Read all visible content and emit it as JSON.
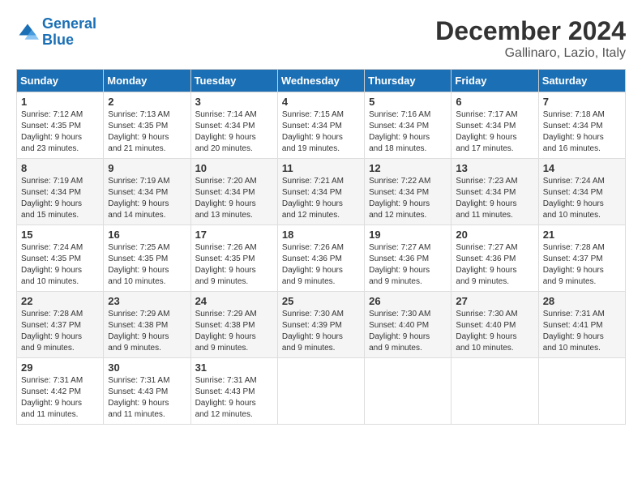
{
  "header": {
    "logo_line1": "General",
    "logo_line2": "Blue",
    "month": "December 2024",
    "location": "Gallinaro, Lazio, Italy"
  },
  "weekdays": [
    "Sunday",
    "Monday",
    "Tuesday",
    "Wednesday",
    "Thursday",
    "Friday",
    "Saturday"
  ],
  "weeks": [
    [
      {
        "day": "1",
        "info": "Sunrise: 7:12 AM\nSunset: 4:35 PM\nDaylight: 9 hours\nand 23 minutes."
      },
      {
        "day": "2",
        "info": "Sunrise: 7:13 AM\nSunset: 4:35 PM\nDaylight: 9 hours\nand 21 minutes."
      },
      {
        "day": "3",
        "info": "Sunrise: 7:14 AM\nSunset: 4:34 PM\nDaylight: 9 hours\nand 20 minutes."
      },
      {
        "day": "4",
        "info": "Sunrise: 7:15 AM\nSunset: 4:34 PM\nDaylight: 9 hours\nand 19 minutes."
      },
      {
        "day": "5",
        "info": "Sunrise: 7:16 AM\nSunset: 4:34 PM\nDaylight: 9 hours\nand 18 minutes."
      },
      {
        "day": "6",
        "info": "Sunrise: 7:17 AM\nSunset: 4:34 PM\nDaylight: 9 hours\nand 17 minutes."
      },
      {
        "day": "7",
        "info": "Sunrise: 7:18 AM\nSunset: 4:34 PM\nDaylight: 9 hours\nand 16 minutes."
      }
    ],
    [
      {
        "day": "8",
        "info": "Sunrise: 7:19 AM\nSunset: 4:34 PM\nDaylight: 9 hours\nand 15 minutes."
      },
      {
        "day": "9",
        "info": "Sunrise: 7:19 AM\nSunset: 4:34 PM\nDaylight: 9 hours\nand 14 minutes."
      },
      {
        "day": "10",
        "info": "Sunrise: 7:20 AM\nSunset: 4:34 PM\nDaylight: 9 hours\nand 13 minutes."
      },
      {
        "day": "11",
        "info": "Sunrise: 7:21 AM\nSunset: 4:34 PM\nDaylight: 9 hours\nand 12 minutes."
      },
      {
        "day": "12",
        "info": "Sunrise: 7:22 AM\nSunset: 4:34 PM\nDaylight: 9 hours\nand 12 minutes."
      },
      {
        "day": "13",
        "info": "Sunrise: 7:23 AM\nSunset: 4:34 PM\nDaylight: 9 hours\nand 11 minutes."
      },
      {
        "day": "14",
        "info": "Sunrise: 7:24 AM\nSunset: 4:34 PM\nDaylight: 9 hours\nand 10 minutes."
      }
    ],
    [
      {
        "day": "15",
        "info": "Sunrise: 7:24 AM\nSunset: 4:35 PM\nDaylight: 9 hours\nand 10 minutes."
      },
      {
        "day": "16",
        "info": "Sunrise: 7:25 AM\nSunset: 4:35 PM\nDaylight: 9 hours\nand 10 minutes."
      },
      {
        "day": "17",
        "info": "Sunrise: 7:26 AM\nSunset: 4:35 PM\nDaylight: 9 hours\nand 9 minutes."
      },
      {
        "day": "18",
        "info": "Sunrise: 7:26 AM\nSunset: 4:36 PM\nDaylight: 9 hours\nand 9 minutes."
      },
      {
        "day": "19",
        "info": "Sunrise: 7:27 AM\nSunset: 4:36 PM\nDaylight: 9 hours\nand 9 minutes."
      },
      {
        "day": "20",
        "info": "Sunrise: 7:27 AM\nSunset: 4:36 PM\nDaylight: 9 hours\nand 9 minutes."
      },
      {
        "day": "21",
        "info": "Sunrise: 7:28 AM\nSunset: 4:37 PM\nDaylight: 9 hours\nand 9 minutes."
      }
    ],
    [
      {
        "day": "22",
        "info": "Sunrise: 7:28 AM\nSunset: 4:37 PM\nDaylight: 9 hours\nand 9 minutes."
      },
      {
        "day": "23",
        "info": "Sunrise: 7:29 AM\nSunset: 4:38 PM\nDaylight: 9 hours\nand 9 minutes."
      },
      {
        "day": "24",
        "info": "Sunrise: 7:29 AM\nSunset: 4:38 PM\nDaylight: 9 hours\nand 9 minutes."
      },
      {
        "day": "25",
        "info": "Sunrise: 7:30 AM\nSunset: 4:39 PM\nDaylight: 9 hours\nand 9 minutes."
      },
      {
        "day": "26",
        "info": "Sunrise: 7:30 AM\nSunset: 4:40 PM\nDaylight: 9 hours\nand 9 minutes."
      },
      {
        "day": "27",
        "info": "Sunrise: 7:30 AM\nSunset: 4:40 PM\nDaylight: 9 hours\nand 10 minutes."
      },
      {
        "day": "28",
        "info": "Sunrise: 7:31 AM\nSunset: 4:41 PM\nDaylight: 9 hours\nand 10 minutes."
      }
    ],
    [
      {
        "day": "29",
        "info": "Sunrise: 7:31 AM\nSunset: 4:42 PM\nDaylight: 9 hours\nand 11 minutes."
      },
      {
        "day": "30",
        "info": "Sunrise: 7:31 AM\nSunset: 4:43 PM\nDaylight: 9 hours\nand 11 minutes."
      },
      {
        "day": "31",
        "info": "Sunrise: 7:31 AM\nSunset: 4:43 PM\nDaylight: 9 hours\nand 12 minutes."
      },
      null,
      null,
      null,
      null
    ]
  ]
}
